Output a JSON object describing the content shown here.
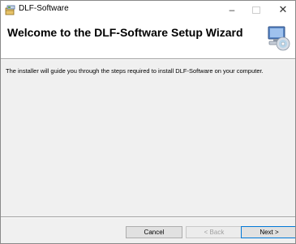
{
  "window": {
    "title": "DLF-Software"
  },
  "header": {
    "title": "Welcome to the DLF-Software Setup Wizard"
  },
  "body": {
    "text": "The installer will guide you through the steps required to install DLF-Software on your computer."
  },
  "buttons": {
    "cancel": "Cancel",
    "back": "< Back",
    "next": "Next >"
  },
  "controls": {
    "minimize": "–",
    "close": "✕"
  },
  "icons": {
    "app": "installer-package-icon",
    "header": "computer-cd-icon"
  },
  "colors": {
    "accent": "#0078d7",
    "disabled_text": "#a0a0a0"
  }
}
